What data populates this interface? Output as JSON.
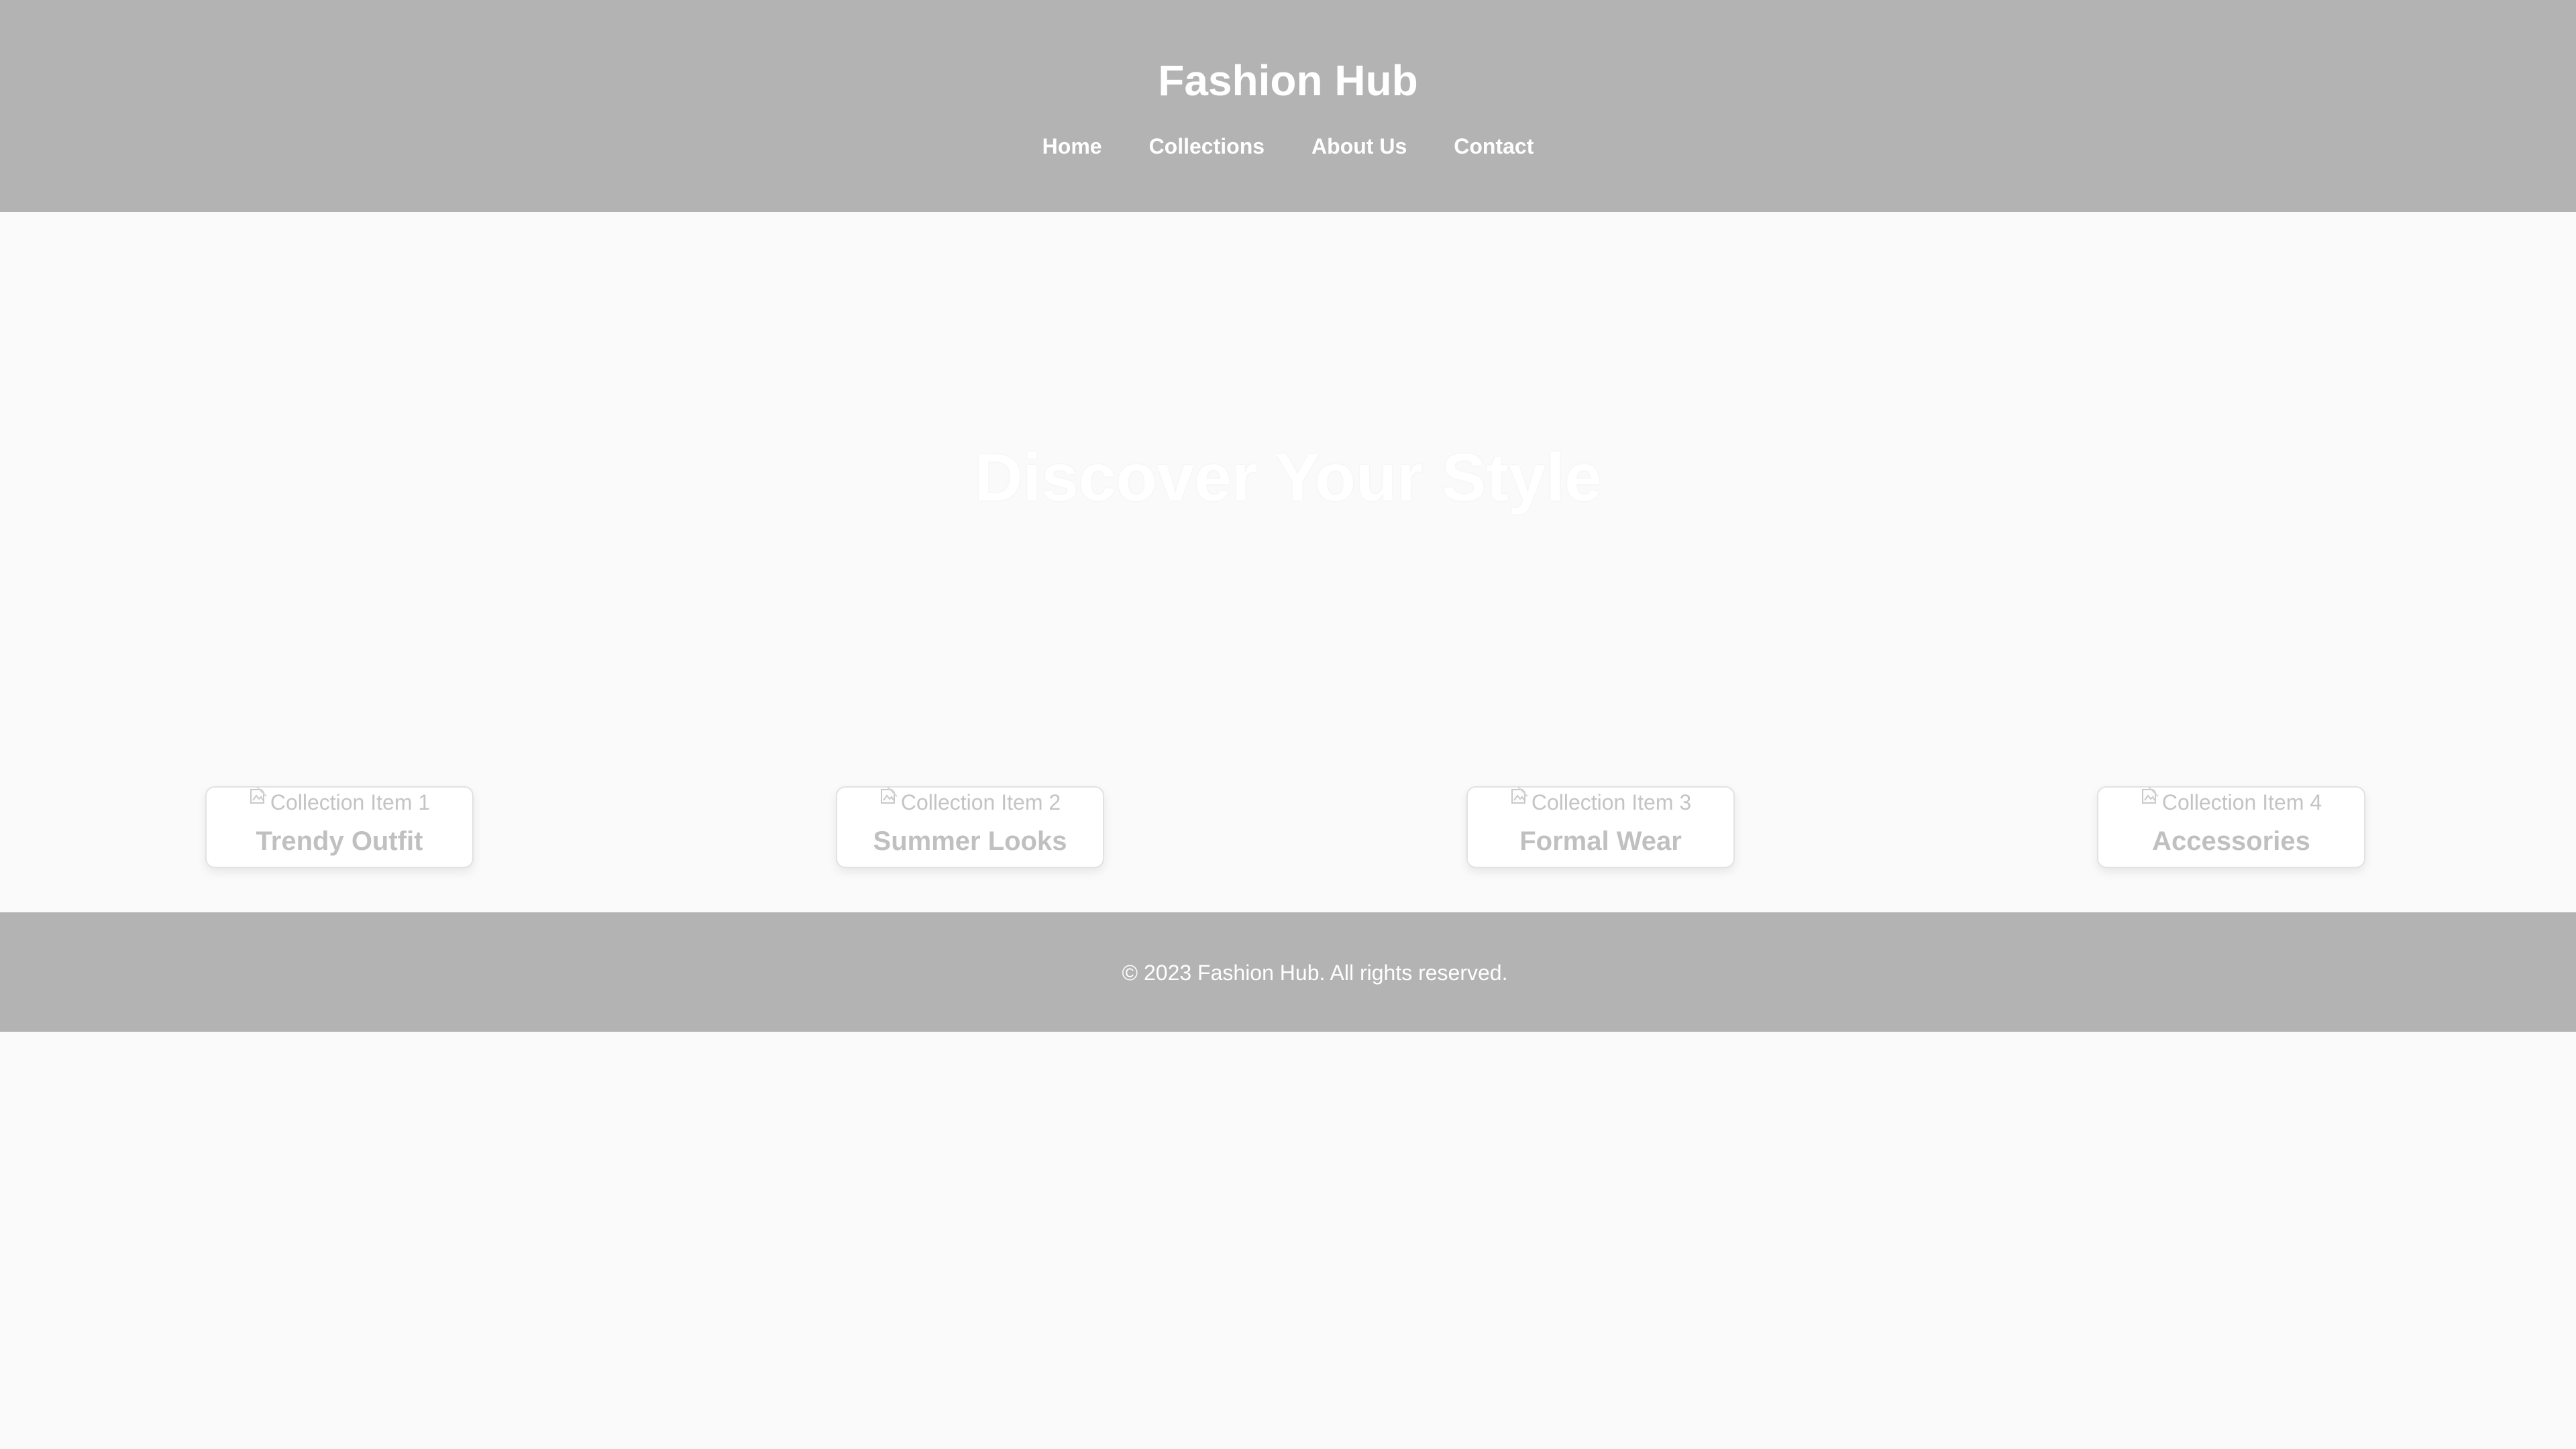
{
  "header": {
    "site_title": "Fashion Hub",
    "nav": [
      {
        "label": "Home"
      },
      {
        "label": "Collections"
      },
      {
        "label": "About Us"
      },
      {
        "label": "Contact"
      }
    ]
  },
  "hero": {
    "title": "Discover Your Style"
  },
  "collections": [
    {
      "img_alt": "Collection Item 1",
      "label": "Trendy Outfit"
    },
    {
      "img_alt": "Collection Item 2",
      "label": "Summer Looks"
    },
    {
      "img_alt": "Collection Item 3",
      "label": "Formal Wear"
    },
    {
      "img_alt": "Collection Item 4",
      "label": "Accessories"
    }
  ],
  "footer": {
    "copyright": "© 2023 Fashion Hub. All rights reserved."
  },
  "colors": {
    "header_bg": "#b3b3b3",
    "page_bg": "#fafafa",
    "card_text": "#c0c0c0"
  },
  "icons": {
    "broken_image": "broken-image-icon"
  }
}
